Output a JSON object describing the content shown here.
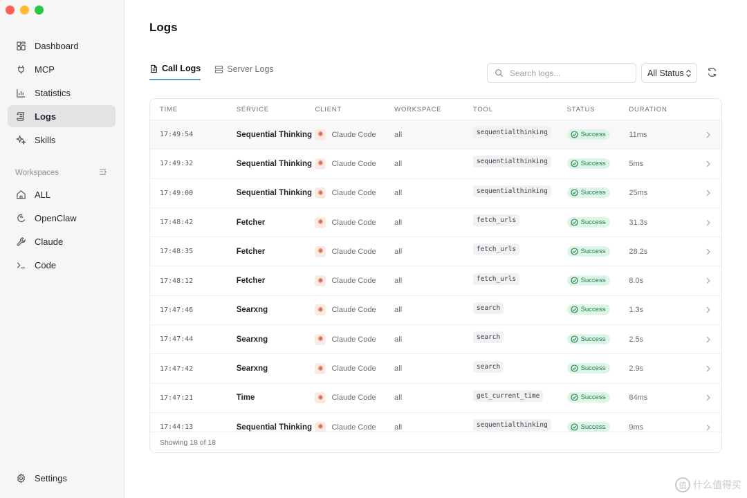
{
  "window": {
    "title": "Logs"
  },
  "sidebar": {
    "items": [
      {
        "name": "sidebar-item-dashboard",
        "label": "Dashboard",
        "icon": "dashboard-icon",
        "active": false
      },
      {
        "name": "sidebar-item-mcp",
        "label": "MCP",
        "icon": "plug-icon",
        "active": false
      },
      {
        "name": "sidebar-item-statistics",
        "label": "Statistics",
        "icon": "bar-chart-icon",
        "active": false
      },
      {
        "name": "sidebar-item-logs",
        "label": "Logs",
        "icon": "scroll-icon",
        "active": true
      },
      {
        "name": "sidebar-item-skills",
        "label": "Skills",
        "icon": "sparkles-icon",
        "active": false
      }
    ],
    "workspaces_label": "Workspaces",
    "workspaces": [
      {
        "name": "workspace-item-all",
        "label": "ALL",
        "icon": "home-icon"
      },
      {
        "name": "workspace-item-openclaw",
        "label": "OpenClaw",
        "icon": "claw-icon"
      },
      {
        "name": "workspace-item-claude",
        "label": "Claude",
        "icon": "wrench-icon"
      },
      {
        "name": "workspace-item-code",
        "label": "Code",
        "icon": "terminal-icon"
      }
    ],
    "settings_label": "Settings"
  },
  "main": {
    "title": "Logs",
    "tabs": [
      {
        "label": "Call Logs",
        "active": true,
        "icon": "file-text-icon"
      },
      {
        "label": "Server Logs",
        "active": false,
        "icon": "server-icon"
      }
    ],
    "search": {
      "placeholder": "Search logs..."
    },
    "status_filter": {
      "selected": "All Status"
    },
    "table": {
      "columns": [
        "TIME",
        "SERVICE",
        "CLIENT",
        "WORKSPACE",
        "TOOL",
        "STATUS",
        "DURATION"
      ],
      "rows": [
        {
          "time": "17:49:54",
          "service": "Sequential Thinking",
          "client": "Claude Code",
          "workspace": "all",
          "tool": "sequentialthinking",
          "status": "Success",
          "duration": "11ms"
        },
        {
          "time": "17:49:32",
          "service": "Sequential Thinking",
          "client": "Claude Code",
          "workspace": "all",
          "tool": "sequentialthinking",
          "status": "Success",
          "duration": "5ms"
        },
        {
          "time": "17:49:00",
          "service": "Sequential Thinking",
          "client": "Claude Code",
          "workspace": "all",
          "tool": "sequentialthinking",
          "status": "Success",
          "duration": "25ms"
        },
        {
          "time": "17:48:42",
          "service": "Fetcher",
          "client": "Claude Code",
          "workspace": "all",
          "tool": "fetch_urls",
          "status": "Success",
          "duration": "31.3s"
        },
        {
          "time": "17:48:35",
          "service": "Fetcher",
          "client": "Claude Code",
          "workspace": "all",
          "tool": "fetch_urls",
          "status": "Success",
          "duration": "28.2s"
        },
        {
          "time": "17:48:12",
          "service": "Fetcher",
          "client": "Claude Code",
          "workspace": "all",
          "tool": "fetch_urls",
          "status": "Success",
          "duration": "8.0s"
        },
        {
          "time": "17:47:46",
          "service": "Searxng",
          "client": "Claude Code",
          "workspace": "all",
          "tool": "search",
          "status": "Success",
          "duration": "1.3s"
        },
        {
          "time": "17:47:44",
          "service": "Searxng",
          "client": "Claude Code",
          "workspace": "all",
          "tool": "search",
          "status": "Success",
          "duration": "2.5s"
        },
        {
          "time": "17:47:42",
          "service": "Searxng",
          "client": "Claude Code",
          "workspace": "all",
          "tool": "search",
          "status": "Success",
          "duration": "2.9s"
        },
        {
          "time": "17:47:21",
          "service": "Time",
          "client": "Claude Code",
          "workspace": "all",
          "tool": "get_current_time",
          "status": "Success",
          "duration": "84ms"
        },
        {
          "time": "17:44:13",
          "service": "Sequential Thinking",
          "client": "Claude Code",
          "workspace": "all",
          "tool": "sequentialthinking",
          "status": "Success",
          "duration": "9ms"
        }
      ],
      "footer": "Showing 18 of 18"
    }
  },
  "watermark": {
    "text": "什么值得买",
    "glyph": "值"
  },
  "colors": {
    "accent": "#5b9bd5",
    "success_bg": "#dcf5e6",
    "success_fg": "#1c7c46",
    "active_nav_bg": "#e4e4e7"
  }
}
